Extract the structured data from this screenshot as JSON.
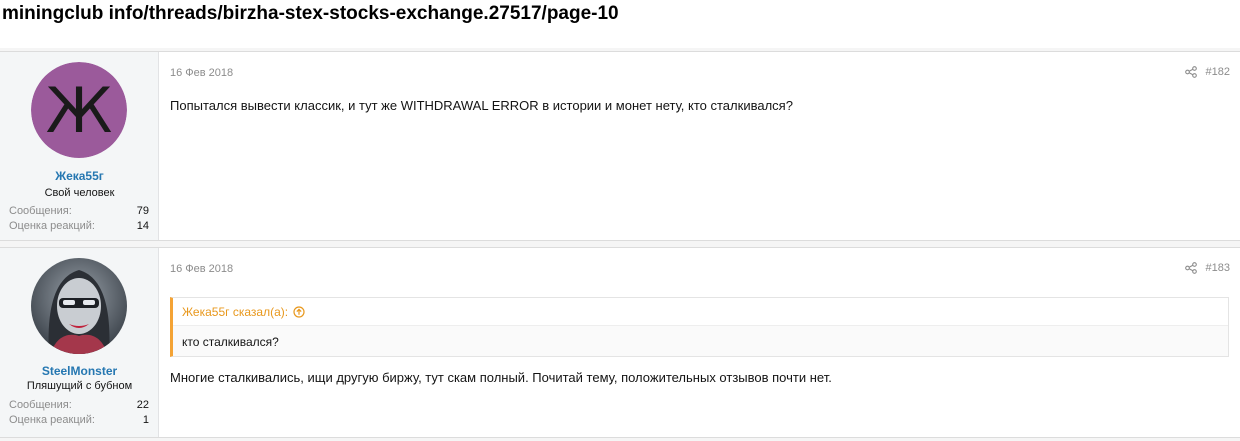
{
  "url": "miningclub info/threads/birzha-stex-stocks-exchange.27517/page-10",
  "posts": [
    {
      "avatar_letter": "Ж",
      "avatar_color": "#9b5a9b",
      "username": "Жека55г",
      "user_title": "Свой человек",
      "stats": {
        "messages_label": "Сообщения:",
        "messages_value": "79",
        "reactions_label": "Оценка реакций:",
        "reactions_value": "14"
      },
      "date": "16 Фев 2018",
      "post_number": "#182",
      "share_icon": "share-icon",
      "body": "Попытался вывести классик, и тут же WITHDRAWAL ERROR в истории и монет нету, кто сталкивался?"
    },
    {
      "username": "SteelMonster",
      "user_title": "Пляшущий с бубном",
      "stats": {
        "messages_label": "Сообщения:",
        "messages_value": "22",
        "reactions_label": "Оценка реакций:",
        "reactions_value": "1"
      },
      "date": "16 Фев 2018",
      "post_number": "#183",
      "share_icon": "share-icon",
      "quote": {
        "author": "Жека55г сказал(а):",
        "text": "кто сталкивался?"
      },
      "body": "Многие сталкивались, ищи другую биржу, тут скам полный. Почитай тему, положительных отзывов почти нет."
    }
  ],
  "colors": {
    "username": "#2577b1",
    "quote_accent": "#f4a335",
    "muted": "#8c8c8c"
  }
}
